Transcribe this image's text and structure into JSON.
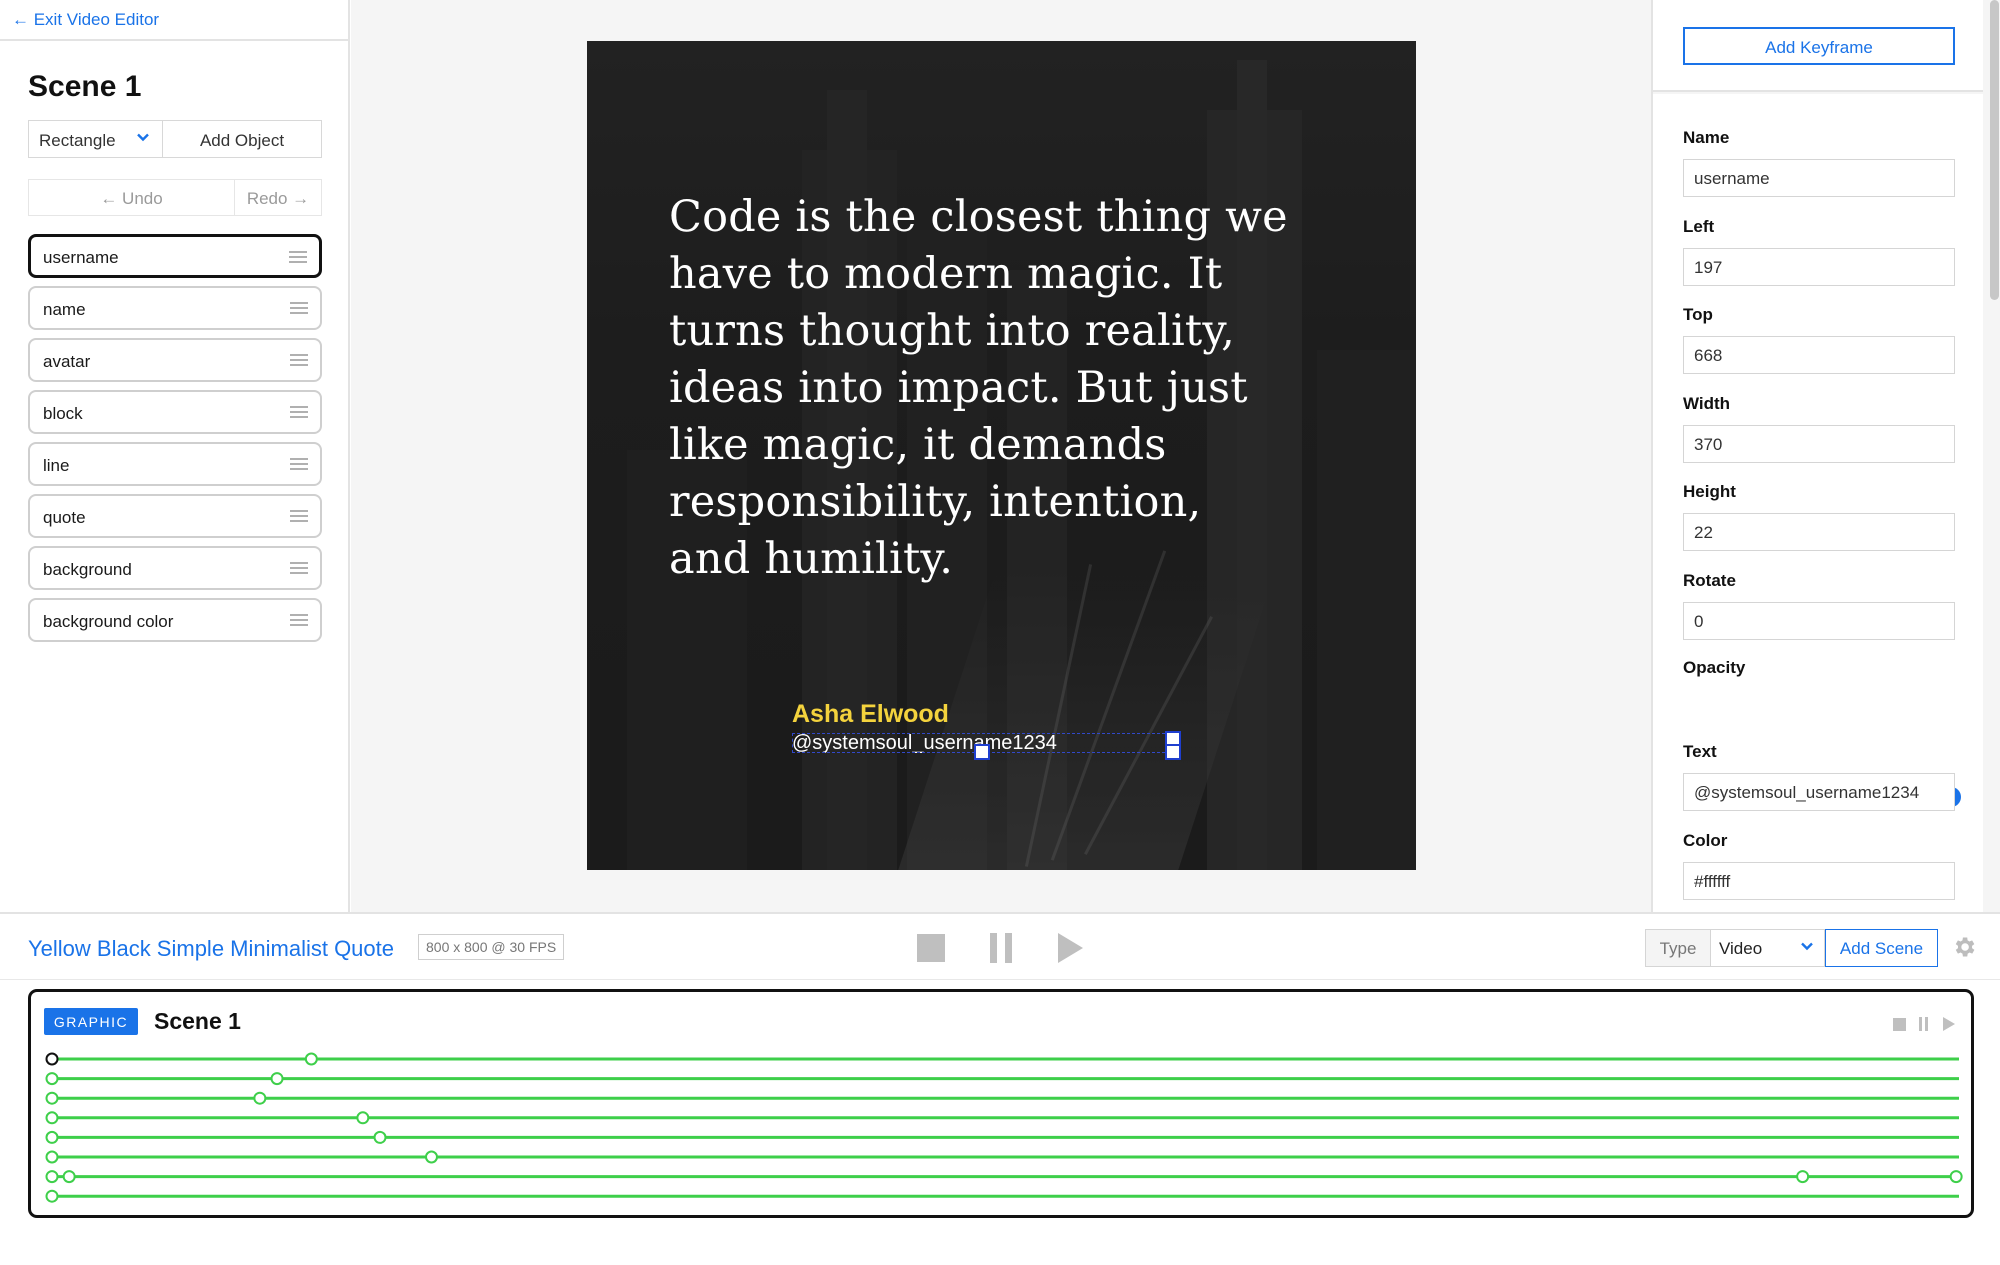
{
  "sidebar": {
    "exit_label": "← Exit Video Editor",
    "scene_title": "Scene 1",
    "shape_select": "Rectangle",
    "add_object": "Add Object",
    "undo": "← Undo",
    "redo": "Redo →",
    "layers": [
      {
        "label": "username",
        "active": true
      },
      {
        "label": "name",
        "active": false
      },
      {
        "label": "avatar",
        "active": false
      },
      {
        "label": "block",
        "active": false
      },
      {
        "label": "line",
        "active": false
      },
      {
        "label": "quote",
        "active": false
      },
      {
        "label": "background",
        "active": false
      },
      {
        "label": "background color",
        "active": false
      }
    ]
  },
  "canvas": {
    "quote": "Code is the closest thing we have to modern magic. It turns thought into reality, ideas into impact. But just like magic, it demands responsibility, intention, and humility.",
    "author_name": "Asha Elwood",
    "author_username": "@systemsoul_username1234",
    "author_color": "#f4d33d"
  },
  "properties": {
    "add_keyframe": "Add Keyframe",
    "fields": [
      {
        "label": "Name",
        "value": "username"
      },
      {
        "label": "Left",
        "value": "197"
      },
      {
        "label": "Top",
        "value": "668"
      },
      {
        "label": "Width",
        "value": "370"
      },
      {
        "label": "Height",
        "value": "22"
      },
      {
        "label": "Rotate",
        "value": "0"
      }
    ],
    "opacity_label": "Opacity",
    "opacity_value": 1.0,
    "text_label": "Text",
    "text_value": "@systemsoul_username1234",
    "color_label": "Color",
    "color_value": "#ffffff"
  },
  "toolbar": {
    "project_title": "Yellow Black Simple Minimalist Quote",
    "project_meta": "800 x 800 @ 30 FPS",
    "type_label": "Type",
    "type_value": "Video",
    "add_scene": "Add Scene"
  },
  "timeline": {
    "badge": "GRAPHIC",
    "scene_title": "Scene 1",
    "track_color": "#3ecf4a",
    "tracks": [
      {
        "keyframes": [
          0.0,
          0.136
        ],
        "first_selected": true
      },
      {
        "keyframes": [
          0.0,
          0.118
        ]
      },
      {
        "keyframes": [
          0.0,
          0.109
        ]
      },
      {
        "keyframes": [
          0.0,
          0.163
        ]
      },
      {
        "keyframes": [
          0.0,
          0.172
        ]
      },
      {
        "keyframes": [
          0.0,
          0.199
        ]
      },
      {
        "keyframes": [
          0.0,
          0.009,
          0.918,
          0.9985
        ]
      },
      {
        "keyframes": [
          0.0
        ]
      }
    ]
  }
}
